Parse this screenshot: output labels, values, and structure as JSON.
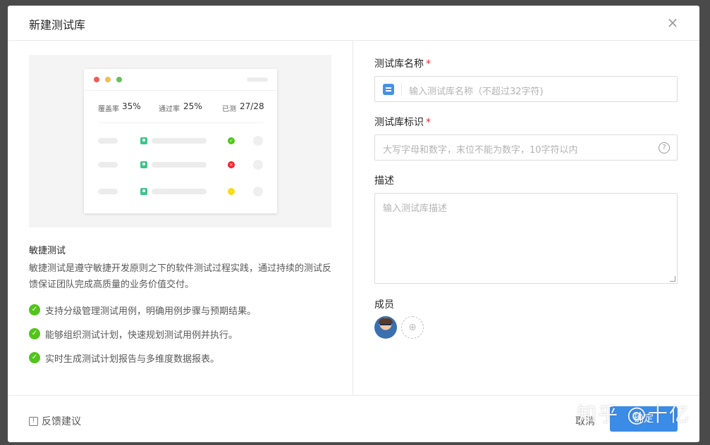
{
  "dialog": {
    "title": "新建测试库",
    "close_icon": "close-icon"
  },
  "preview": {
    "stats": [
      {
        "label": "覆盖率",
        "value": "35%"
      },
      {
        "label": "通过率",
        "value": "25%"
      },
      {
        "label": "已测",
        "value": "27/28"
      }
    ],
    "traffic_lights": [
      "#ed5d56",
      "#f4bd4f",
      "#61c454"
    ],
    "status_colors": [
      "#52c41a",
      "#f5222d",
      "#fadb14"
    ]
  },
  "intro": {
    "title": "敏捷测试",
    "description": "敏捷测试是遵守敏捷开发原则之下的软件测试过程实践，通过持续的测试反馈保证团队完成高质量的业务价值交付。",
    "features": [
      "支持分级管理测试用例，明确用例步骤与预期结果。",
      "能够组织测试计划，快速规划测试用例并执行。",
      "实时生成测试计划报告与多维度数据报表。"
    ]
  },
  "form": {
    "name_label": "测试库名称",
    "name_placeholder": "输入测试库名称（不超过32字符)",
    "identifier_label": "测试库标识",
    "identifier_placeholder": "大写字母和数字，末位不能为数字，10字符以内",
    "description_label": "描述",
    "description_placeholder": "输入测试库描述",
    "members_label": "成员",
    "required_mark": "*"
  },
  "footer": {
    "feedback": "反馈建议",
    "cancel": "取消",
    "ok": "确定"
  },
  "watermark": "知乎 @十亿",
  "colors": {
    "primary": "#3b8ce6",
    "success": "#52c41a",
    "required": "#f5222d"
  }
}
